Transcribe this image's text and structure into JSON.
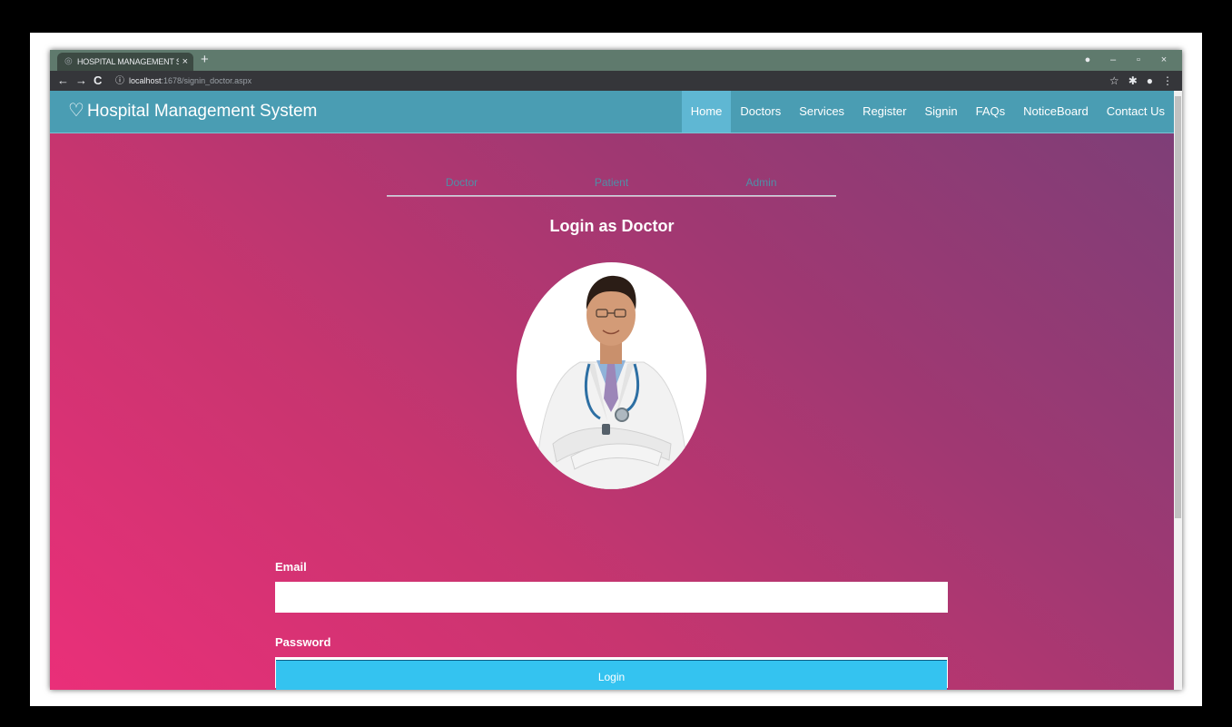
{
  "browser": {
    "tab_title": "HOSPITAL MANAGEMENT SYSTE",
    "tab_close": "×",
    "new_tab": "+",
    "url_host": "localhost",
    "url_path": ":1678/signin_doctor.aspx",
    "window_controls": [
      "●",
      "–",
      "▫",
      "×"
    ],
    "toolbar_icons": [
      "☆",
      "✱",
      "●",
      "⋮"
    ]
  },
  "site": {
    "brand": "Hospital Management System",
    "brand_icon": "stethoscope-icon",
    "menu": [
      "Home",
      "Doctors",
      "Services",
      "Register",
      "Signin",
      "FAQs",
      "NoticeBoard",
      "Contact Us"
    ],
    "active_menu": "Home"
  },
  "role_tabs": [
    "Doctor",
    "Patient",
    "Admin"
  ],
  "heading": "Login as Doctor",
  "form": {
    "email_label": "Email",
    "email_value": "",
    "password_label": "Password",
    "password_value": "",
    "login_label": "Login"
  },
  "colors": {
    "navbar": "#4a9db3",
    "active_menu": "#5fb7d3",
    "login_button": "#34c3f0",
    "gradient_start": "#ea2f79",
    "gradient_end": "#7b3f78"
  }
}
